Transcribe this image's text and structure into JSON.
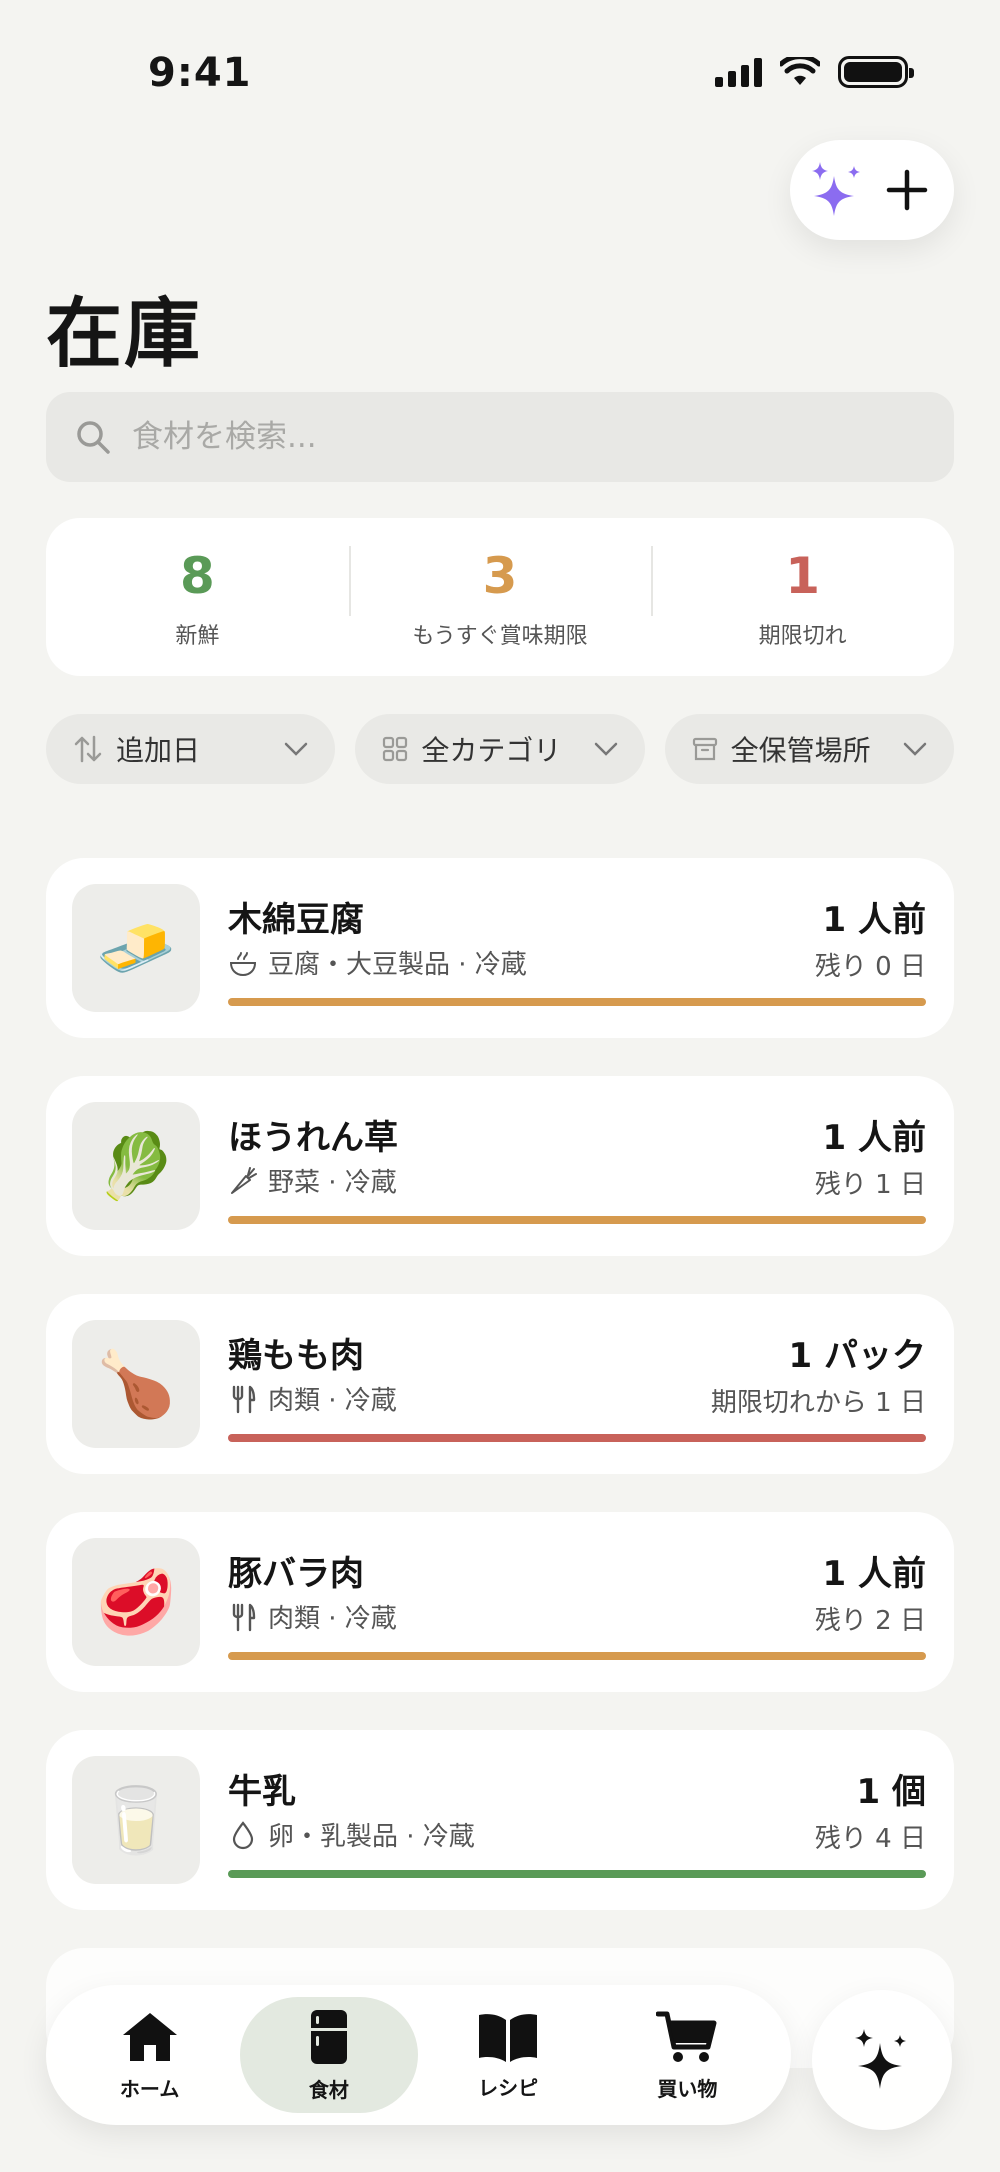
{
  "status_bar": {
    "time": "9:41"
  },
  "page": {
    "title": "在庫"
  },
  "search": {
    "placeholder": "食材を検索..."
  },
  "stats": [
    {
      "value": "8",
      "label": "新鮮",
      "color": "#5a9a57"
    },
    {
      "value": "3",
      "label": "もうすぐ賞味期限",
      "color": "#d69a4e"
    },
    {
      "value": "1",
      "label": "期限切れ",
      "color": "#c8625a"
    }
  ],
  "filters": [
    {
      "label": "追加日",
      "icon": "sort-icon"
    },
    {
      "label": "全カテゴリ",
      "icon": "grid-icon"
    },
    {
      "label": "全保管場所",
      "icon": "box-icon"
    }
  ],
  "items": [
    {
      "name": "木綿豆腐",
      "quantity": "1 人前",
      "category": "豆腐・大豆製品 · 冷蔵",
      "remaining": "残り 0 日",
      "status_color": "#d69a4e",
      "icon": "tofu-icon",
      "emoji": "🧈"
    },
    {
      "name": "ほうれん草",
      "quantity": "1 人前",
      "category": "野菜 · 冷蔵",
      "remaining": "残り 1 日",
      "status_color": "#d69a4e",
      "icon": "carrot-icon",
      "emoji": "🥬"
    },
    {
      "name": "鶏もも肉",
      "quantity": "1 パック",
      "category": "肉類 · 冷蔵",
      "remaining": "期限切れから 1 日",
      "status_color": "#c8625a",
      "icon": "utensils-icon",
      "emoji": "🍗"
    },
    {
      "name": "豚バラ肉",
      "quantity": "1 人前",
      "category": "肉類 · 冷蔵",
      "remaining": "残り 2 日",
      "status_color": "#d69a4e",
      "icon": "utensils-icon",
      "emoji": "🥩"
    },
    {
      "name": "牛乳",
      "quantity": "1 個",
      "category": "卵・乳製品 · 冷蔵",
      "remaining": "残り 4 日",
      "status_color": "#5a9a57",
      "icon": "drop-icon",
      "emoji": "🥛"
    }
  ],
  "tabs": [
    {
      "label": "ホーム",
      "icon": "home-icon",
      "active": false
    },
    {
      "label": "食材",
      "icon": "fridge-icon",
      "active": true
    },
    {
      "label": "レシピ",
      "icon": "book-icon",
      "active": false
    },
    {
      "label": "買い物",
      "icon": "cart-icon",
      "active": false
    }
  ],
  "colors": {
    "accent_sparkle": "#8b6cf0",
    "background": "#f4f4f1"
  }
}
